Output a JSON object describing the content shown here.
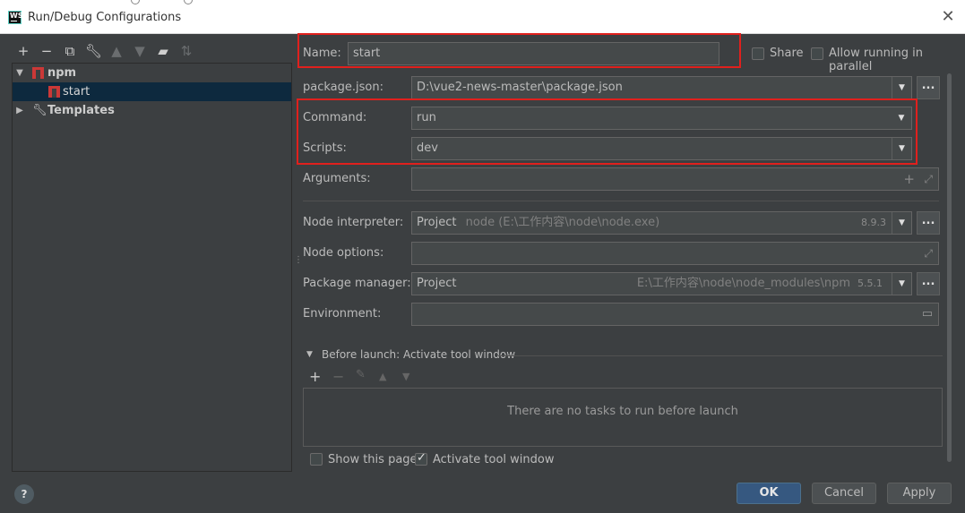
{
  "window": {
    "title": "Run/Debug Configurations",
    "logo_text": "WS"
  },
  "tree": {
    "items": [
      {
        "label": "npm",
        "type": "group",
        "expanded": true
      },
      {
        "label": "start",
        "type": "config",
        "selected": true
      },
      {
        "label": "Templates",
        "type": "group",
        "expanded": false
      }
    ]
  },
  "form": {
    "name_label": "Name:",
    "name_value": "start",
    "share_label": "Share",
    "allow_parallel_label": "Allow running in parallel",
    "package_json_label": "package.json:",
    "package_json_value": "D:\\vue2-news-master\\package.json",
    "command_label": "Command:",
    "command_value": "run",
    "scripts_label": "Scripts:",
    "scripts_value": "dev",
    "arguments_label": "Arguments:",
    "arguments_value": "",
    "node_interpreter_label": "Node interpreter:",
    "node_interpreter_value": "Project",
    "node_interpreter_path": "node (E:\\工作内容\\node\\node.exe)",
    "node_interpreter_version": "8.9.3",
    "node_options_label": "Node options:",
    "node_options_value": "",
    "package_manager_label": "Package manager:",
    "package_manager_value": "Project",
    "package_manager_path": "E:\\工作内容\\node\\node_modules\\npm",
    "package_manager_version": "5.5.1",
    "environment_label": "Environment:",
    "environment_value": ""
  },
  "before_launch": {
    "title": "Before launch: Activate tool window",
    "empty_text": "There are no tasks to run before launch",
    "show_page_label": "Show this page",
    "activate_label": "Activate tool window",
    "show_page_checked": false,
    "activate_checked": true
  },
  "buttons": {
    "ok": "OK",
    "cancel": "Cancel",
    "apply": "Apply",
    "help": "?"
  },
  "colors": {
    "highlight_box": "#e0201d",
    "background": "#3c3f41",
    "selection": "#0d293e",
    "primary_button": "#365880"
  }
}
